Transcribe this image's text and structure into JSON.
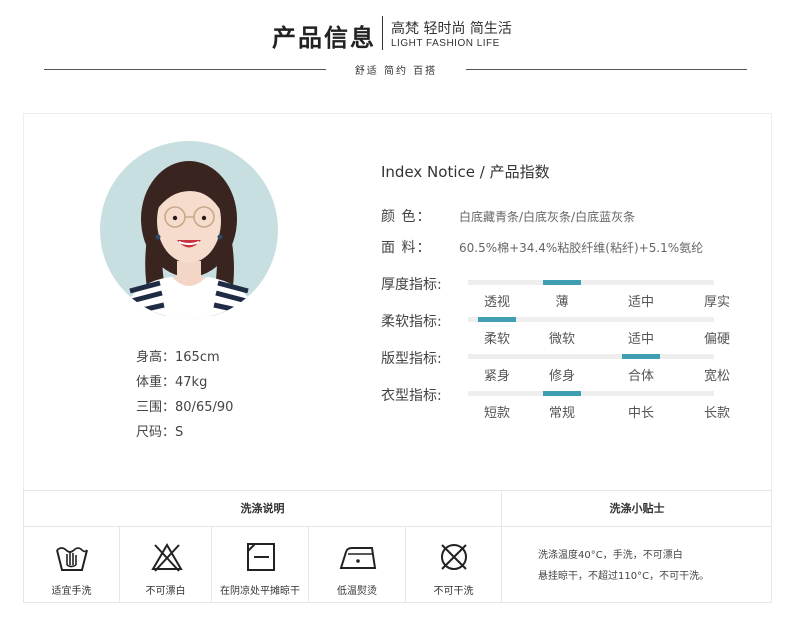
{
  "header": {
    "title": "产品信息",
    "subtitle": "高梵 轻时尚 简生活",
    "subtitle_en": "LIGHT FASHION LIFE",
    "tagline": "舒适  简约  百搭"
  },
  "model": {
    "specs": [
      {
        "label": "身高：",
        "value": "165cm"
      },
      {
        "label": "体重：",
        "value": "47kg"
      },
      {
        "label": "三围：",
        "value": "80/65/90"
      },
      {
        "label": "尺码：",
        "value": "S"
      }
    ]
  },
  "index": {
    "title": "Index Notice / 产品指数",
    "color": {
      "label": "颜    色：",
      "value": "白底藏青条/白底灰条/白底蓝灰条"
    },
    "fabric": {
      "label": "面    料：",
      "value": "60.5%棉+34.4%粘胶纤维(粘纤)+5.1%氨纶"
    },
    "indicators": [
      {
        "label": "厚度指标:",
        "options": [
          "透视",
          "薄",
          "适中",
          "厚实"
        ],
        "selected": 1
      },
      {
        "label": "柔软指标:",
        "options": [
          "柔软",
          "微软",
          "适中",
          "偏硬"
        ],
        "selected": 0
      },
      {
        "label": "版型指标:",
        "options": [
          "紧身",
          "修身",
          "合体",
          "宽松"
        ],
        "selected": 2
      },
      {
        "label": "衣型指标:",
        "options": [
          "短款",
          "常规",
          "中长",
          "长款"
        ],
        "selected": 1
      }
    ]
  },
  "care": {
    "heading": "洗涤说明",
    "tips_heading": "洗涤小贴士",
    "items": [
      {
        "icon": "hand-wash-icon",
        "label": "适宜手洗"
      },
      {
        "icon": "no-bleach-icon",
        "label": "不可漂白"
      },
      {
        "icon": "dry-flat-shade-icon",
        "label": "在阴凉处平摊晾干"
      },
      {
        "icon": "low-iron-icon",
        "label": "低温熨烫"
      },
      {
        "icon": "no-dry-clean-icon",
        "label": "不可干洗"
      }
    ],
    "tips": [
      "洗涤温度40°C，手洗，不可漂白",
      "悬挂晾干，不超过110°C，不可干洗。"
    ]
  },
  "colors": {
    "accent": "#3f9eb1",
    "photo_bg": "#c7dfe0"
  }
}
